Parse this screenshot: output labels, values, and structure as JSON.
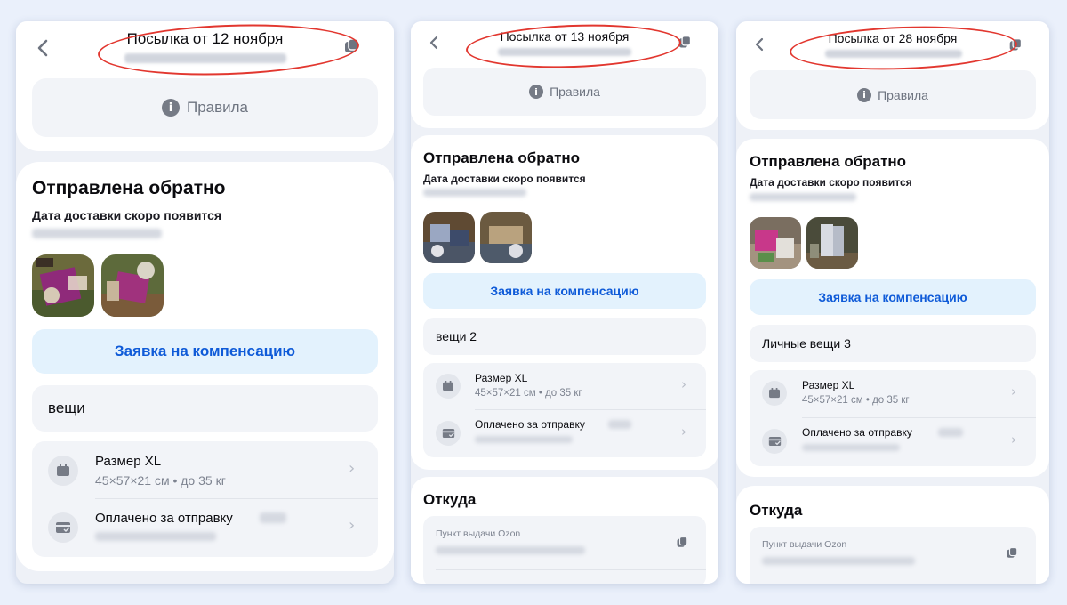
{
  "colors": {
    "background": "#eaf0fb",
    "accent_blue": "#0f5bd8",
    "compensation_bg": "#e3f2fd",
    "marker_red": "#e2372f"
  },
  "phones": [
    {
      "title": "Посылка от 12 ноября",
      "rules_label": "Правила",
      "status": "Отправлена обратно",
      "delivery_note": "Дата доставки скоро появится",
      "compensation_button": "Заявка на компенсацию",
      "items_label": "вещи",
      "size_title": "Размер XL",
      "size_detail": "45×57×21 см • до 35 кг",
      "payment_title": "Оплачено за отправку",
      "icons": [
        "back-arrow-icon",
        "copy-icon",
        "info-icon",
        "box-icon",
        "card-icon",
        "chevron-right-icon"
      ]
    },
    {
      "title": "Посылка от 13 ноября",
      "rules_label": "Правила",
      "status": "Отправлена обратно",
      "delivery_note": "Дата доставки скоро появится",
      "compensation_button": "Заявка на компенсацию",
      "items_label": "вещи 2",
      "size_title": "Размер XL",
      "size_detail": "45×57×21 см • до 35 кг",
      "payment_title": "Оплачено за отправку",
      "from_title": "Откуда",
      "pickup_label": "Пункт выдачи Ozon",
      "icons": [
        "back-arrow-icon",
        "copy-icon",
        "info-icon",
        "box-icon",
        "card-icon",
        "chevron-right-icon"
      ]
    },
    {
      "title": "Посылка от 28 ноября",
      "rules_label": "Правила",
      "status": "Отправлена обратно",
      "delivery_note": "Дата доставки скоро появится",
      "compensation_button": "Заявка на компенсацию",
      "items_label": "Личные вещи 3",
      "size_title": "Размер XL",
      "size_detail": "45×57×21 см • до 35 кг",
      "payment_title": "Оплачено за отправку",
      "from_title": "Откуда",
      "pickup_label": "Пункт выдачи Ozon",
      "icons": [
        "back-arrow-icon",
        "copy-icon",
        "info-icon",
        "box-icon",
        "card-icon",
        "chevron-right-icon"
      ]
    }
  ]
}
